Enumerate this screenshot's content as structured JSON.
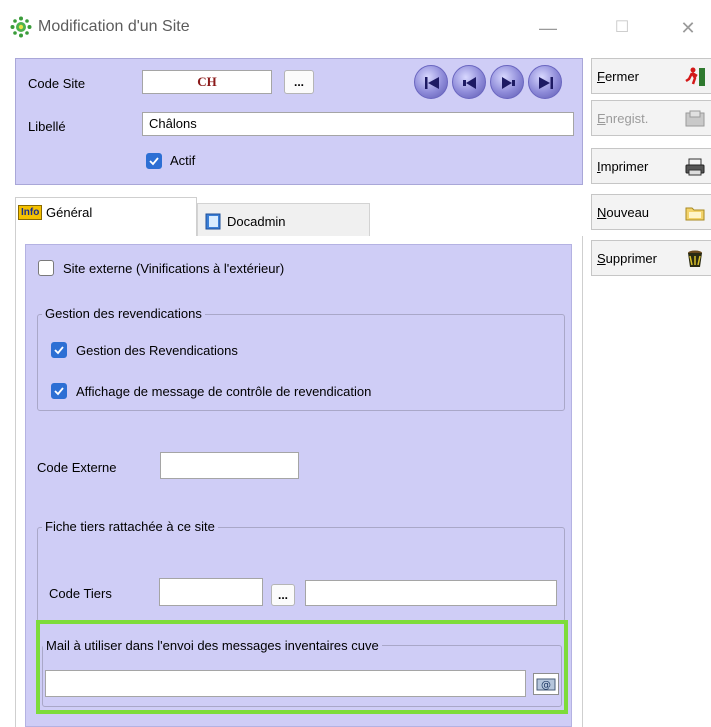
{
  "window": {
    "title": "Modification d'un Site",
    "minimize_glyph": "—",
    "maximize_glyph": "☐",
    "close_glyph": "✕"
  },
  "header": {
    "code_site_label": "Code Site",
    "code_site_value": "CH",
    "browse_label": "...",
    "libelle_label": "Libellé",
    "libelle_value": "Châlons",
    "actif_label": "Actif",
    "actif_checked": true
  },
  "actions": {
    "fermer": "Fermer",
    "enregist": "Enregist.",
    "imprimer": "Imprimer",
    "nouveau": "Nouveau",
    "supprimer": "Supprimer"
  },
  "tabs": [
    {
      "label": "Général",
      "badge": "Info",
      "active": true
    },
    {
      "label": "Docadmin",
      "active": false
    }
  ],
  "general": {
    "site_externe_label": "Site externe (Vinifications à l'extérieur)",
    "site_externe_checked": false,
    "revendications_group": "Gestion des revendications",
    "gestion_revendications_label": "Gestion des Revendications",
    "gestion_revendications_checked": true,
    "affichage_message_label": "Affichage de message de contrôle de revendication",
    "affichage_message_checked": true,
    "code_externe_label": "Code Externe",
    "code_externe_value": "",
    "fiche_tiers_group": "Fiche tiers rattachée à ce site",
    "code_tiers_label": "Code Tiers",
    "code_tiers_value": "",
    "code_tiers_browse": "...",
    "tiers_name_value": "",
    "mail_group": "Mail à utiliser dans l'envoi des messages inventaires cuve",
    "mail_value": ""
  },
  "colors": {
    "panel": "#cfcdf6",
    "highlight": "#7ddc3a",
    "check": "#2d6fd4",
    "code_site_text": "#8b1a1a"
  }
}
